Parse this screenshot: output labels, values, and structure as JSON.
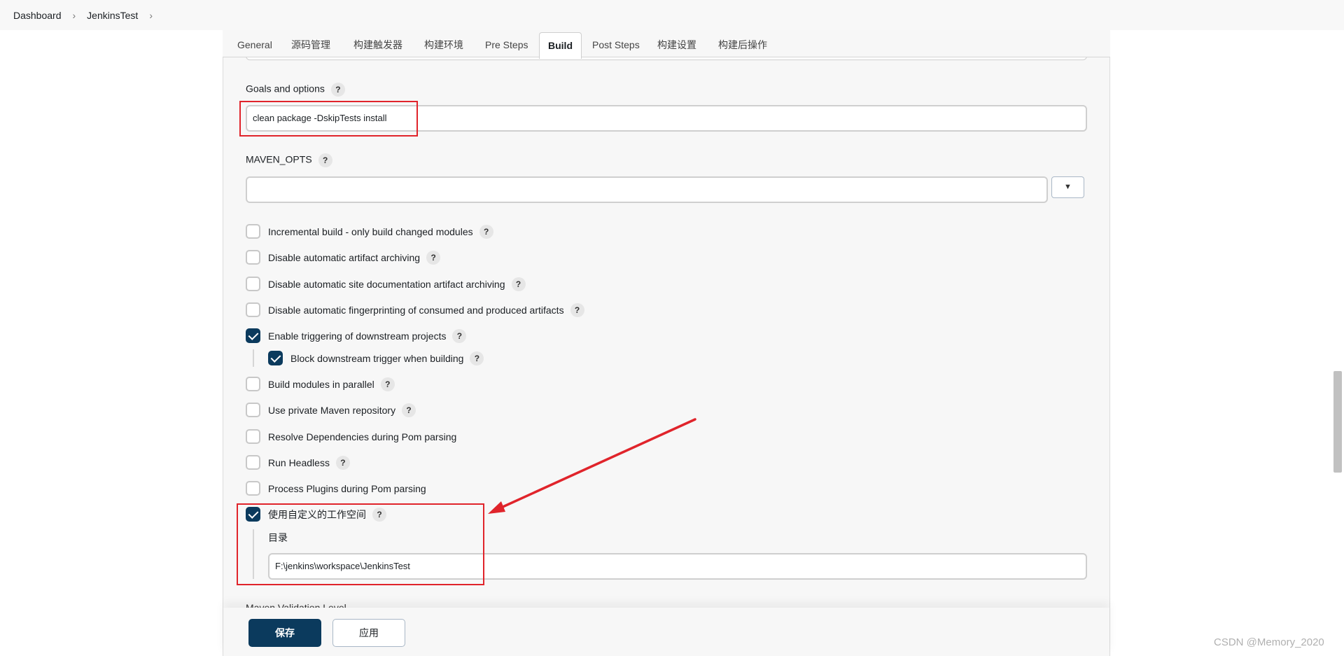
{
  "breadcrumb": [
    "Dashboard",
    "JenkinsTest"
  ],
  "tabs": [
    "General",
    "源码管理",
    "构建触发器",
    "构建环境",
    "Pre Steps",
    "Build",
    "Post Steps",
    "构建设置",
    "构建后操作"
  ],
  "active_tab": "Build",
  "goals": {
    "label": "Goals and options",
    "value": "clean package -DskipTests install"
  },
  "maven_opts": {
    "label": "MAVEN_OPTS",
    "value": ""
  },
  "options": [
    {
      "label": "Incremental build - only build changed modules",
      "checked": false,
      "help": true
    },
    {
      "label": "Disable automatic artifact archiving",
      "checked": false,
      "help": true
    },
    {
      "label": "Disable automatic site documentation artifact archiving",
      "checked": false,
      "help": true
    },
    {
      "label": "Disable automatic fingerprinting of consumed and produced artifacts",
      "checked": false,
      "help": true
    },
    {
      "label": "Enable triggering of downstream projects",
      "checked": true,
      "help": true
    },
    {
      "label": "Block downstream trigger when building",
      "checked": true,
      "help": true
    },
    {
      "label": "Build modules in parallel",
      "checked": false,
      "help": true
    },
    {
      "label": "Use private Maven repository",
      "checked": false,
      "help": true
    },
    {
      "label": "Resolve Dependencies during Pom parsing",
      "checked": false,
      "help": false
    },
    {
      "label": "Run Headless",
      "checked": false,
      "help": true
    },
    {
      "label": "Process Plugins during Pom parsing",
      "checked": false,
      "help": false
    },
    {
      "label": "使用自定义的工作空间",
      "checked": true,
      "help": true
    }
  ],
  "custom_workspace": {
    "dir_label": "目录",
    "dir_value": "F:\\jenkins\\workspace\\JenkinsTest"
  },
  "cut_label": "Maven Validation Level",
  "help_glyph": "?",
  "dropdown_glyph": "▼",
  "buttons": {
    "save": "保存",
    "apply": "应用"
  },
  "watermark": "CSDN @Memory_2020",
  "colors": {
    "primary": "#0b3a5d",
    "annotation": "#e0242b"
  }
}
